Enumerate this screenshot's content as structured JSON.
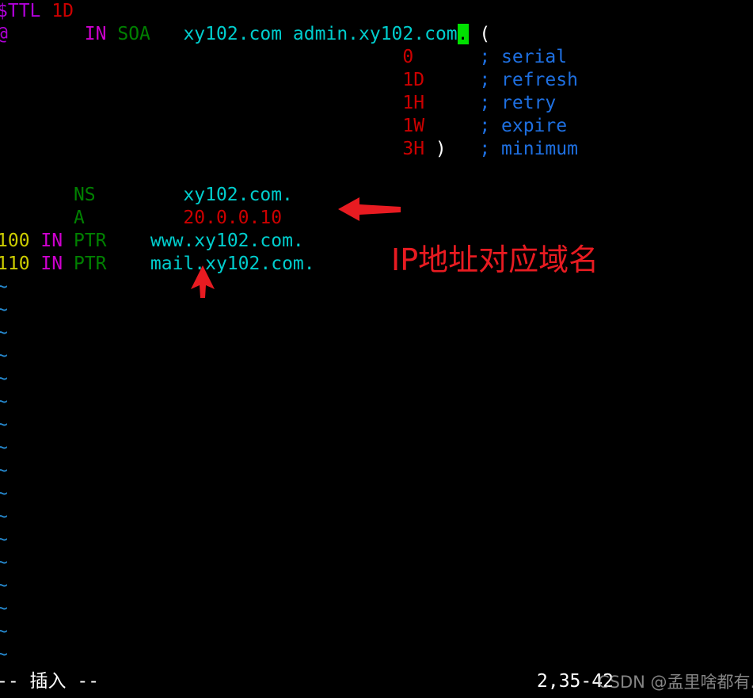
{
  "app": {
    "name": "vim",
    "file_type": "dns-zone-file"
  },
  "colors": {
    "background": "#000000",
    "directive": "#af00d7",
    "number": "#cc0000",
    "class": "#cf00cf",
    "rrtype": "#008000",
    "name": "#00cdcd",
    "comment": "#1e6fe0",
    "yellow_number": "#cdcd00",
    "tilde": "#268bd2",
    "cursor": "#00e000",
    "annotation_red": "#e81b21",
    "watermark": "#b9b9b9"
  },
  "editor": {
    "lines": [
      {
        "id": "line-ttl",
        "segments": [
          {
            "text": "$TTL",
            "cls": "tok-directive"
          },
          {
            "text": " ",
            "cls": "tok-plain"
          },
          {
            "text": "1D",
            "cls": "tok-number"
          }
        ]
      },
      {
        "id": "line-soa",
        "segments": [
          {
            "text": "@",
            "cls": "tok-at"
          },
          {
            "text": "       ",
            "cls": "tok-plain"
          },
          {
            "text": "IN",
            "cls": "tok-class"
          },
          {
            "text": " ",
            "cls": "tok-plain"
          },
          {
            "text": "SOA",
            "cls": "tok-type"
          },
          {
            "text": "   ",
            "cls": "tok-plain"
          },
          {
            "text": "xy102.com admin.xy102.com",
            "cls": "tok-name"
          },
          {
            "text": ".",
            "cls": "cursor-block"
          },
          {
            "text": " ",
            "cls": "tok-plain"
          },
          {
            "text": "(",
            "cls": "tok-paren"
          }
        ]
      },
      {
        "id": "line-serial",
        "segments": [
          {
            "text": "                                     ",
            "cls": "tok-plain"
          },
          {
            "text": "0",
            "cls": "tok-number"
          },
          {
            "text": "      ",
            "cls": "tok-plain"
          },
          {
            "text": "; serial",
            "cls": "tok-comment"
          }
        ]
      },
      {
        "id": "line-refresh",
        "segments": [
          {
            "text": "                                     ",
            "cls": "tok-plain"
          },
          {
            "text": "1D",
            "cls": "tok-number"
          },
          {
            "text": "     ",
            "cls": "tok-plain"
          },
          {
            "text": "; refresh",
            "cls": "tok-comment"
          }
        ]
      },
      {
        "id": "line-retry",
        "segments": [
          {
            "text": "                                     ",
            "cls": "tok-plain"
          },
          {
            "text": "1H",
            "cls": "tok-number"
          },
          {
            "text": "     ",
            "cls": "tok-plain"
          },
          {
            "text": "; retry",
            "cls": "tok-comment"
          }
        ]
      },
      {
        "id": "line-expire",
        "segments": [
          {
            "text": "                                     ",
            "cls": "tok-plain"
          },
          {
            "text": "1W",
            "cls": "tok-number"
          },
          {
            "text": "     ",
            "cls": "tok-plain"
          },
          {
            "text": "; expire",
            "cls": "tok-comment"
          }
        ]
      },
      {
        "id": "line-minimum",
        "segments": [
          {
            "text": "                                     ",
            "cls": "tok-plain"
          },
          {
            "text": "3H",
            "cls": "tok-number"
          },
          {
            "text": " ",
            "cls": "tok-plain"
          },
          {
            "text": ")",
            "cls": "tok-paren"
          },
          {
            "text": "   ",
            "cls": "tok-plain"
          },
          {
            "text": "; minimum",
            "cls": "tok-comment"
          }
        ]
      },
      {
        "id": "line-blank-1",
        "segments": [
          {
            "text": "",
            "cls": "tok-plain"
          }
        ]
      },
      {
        "id": "line-ns",
        "segments": [
          {
            "text": "       ",
            "cls": "tok-plain"
          },
          {
            "text": "NS",
            "cls": "tok-type"
          },
          {
            "text": "        ",
            "cls": "tok-plain"
          },
          {
            "text": "xy102.com.",
            "cls": "tok-name"
          }
        ]
      },
      {
        "id": "line-a",
        "segments": [
          {
            "text": "       ",
            "cls": "tok-plain"
          },
          {
            "text": "A",
            "cls": "tok-type"
          },
          {
            "text": "         ",
            "cls": "tok-plain"
          },
          {
            "text": "20.0.0.10",
            "cls": "tok-ip"
          }
        ]
      },
      {
        "id": "line-ptr-www",
        "segments": [
          {
            "text": "100",
            "cls": "tok-num-y"
          },
          {
            "text": " ",
            "cls": "tok-plain"
          },
          {
            "text": "IN",
            "cls": "tok-class"
          },
          {
            "text": " ",
            "cls": "tok-plain"
          },
          {
            "text": "PTR",
            "cls": "tok-type"
          },
          {
            "text": "    ",
            "cls": "tok-plain"
          },
          {
            "text": "www.xy102.com.",
            "cls": "tok-name"
          }
        ]
      },
      {
        "id": "line-ptr-mail",
        "segments": [
          {
            "text": "110",
            "cls": "tok-num-y"
          },
          {
            "text": " ",
            "cls": "tok-plain"
          },
          {
            "text": "IN",
            "cls": "tok-class"
          },
          {
            "text": " ",
            "cls": "tok-plain"
          },
          {
            "text": "PTR",
            "cls": "tok-type"
          },
          {
            "text": "    ",
            "cls": "tok-plain"
          },
          {
            "text": "mail.xy102.com.",
            "cls": "tok-name"
          }
        ]
      }
    ],
    "empty_line_marker": "~",
    "empty_line_count": 17
  },
  "statusline": {
    "mode": "-- 插入 --",
    "ruler": "2,35-42"
  },
  "annotations": {
    "label": "IP地址对应域名",
    "arrow_left_name": "arrow-pointing-left",
    "arrow_up_name": "arrow-pointing-up"
  },
  "watermark": {
    "text": "CSDN @孟里啥都有."
  }
}
